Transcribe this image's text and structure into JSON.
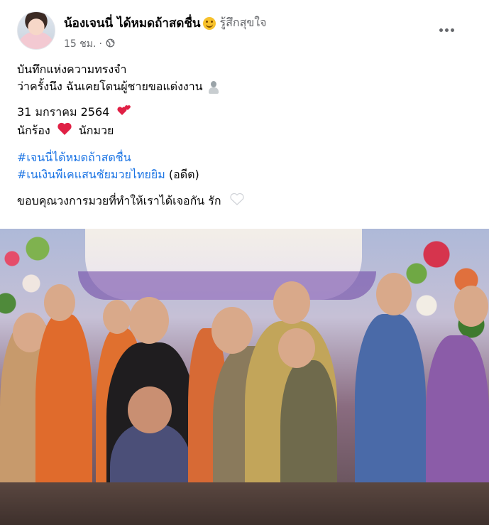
{
  "post": {
    "author_name": "น้องเจนนี่ ได้หมดถ้าสดชื่น",
    "feeling": "รู้สึกสุขใจ",
    "timestamp": "15 ชม.",
    "separator": "·",
    "privacy_icon": "globe-icon",
    "more_icon": "more-horizontal-icon",
    "lines": {
      "l1": "บันทึกแห่งความทรงจำ",
      "l2": "ว่าครั้งนึง ฉันเคยโดนผู้ชายขอแต่งงาน",
      "l3": "31 มกราคม 2564",
      "l4a": "นักร้อง",
      "l4b": "นักมวย",
      "hashtag1": "#เจนนี่ได้หมดถ้าสดชื่น",
      "hashtag2": "#เนเงินพีเคแสนชัยมวยไทยยิม",
      "hashtag2_suffix": " (อดีต)",
      "l7": "ขอบคุณวงการมวยที่ทำให้เราได้เจอกัน รัก"
    },
    "colors": {
      "hashtag": "#1b74e4",
      "heart": "#e02045",
      "meta_text": "#65676b"
    },
    "photo_icon": "proposal-photo"
  }
}
